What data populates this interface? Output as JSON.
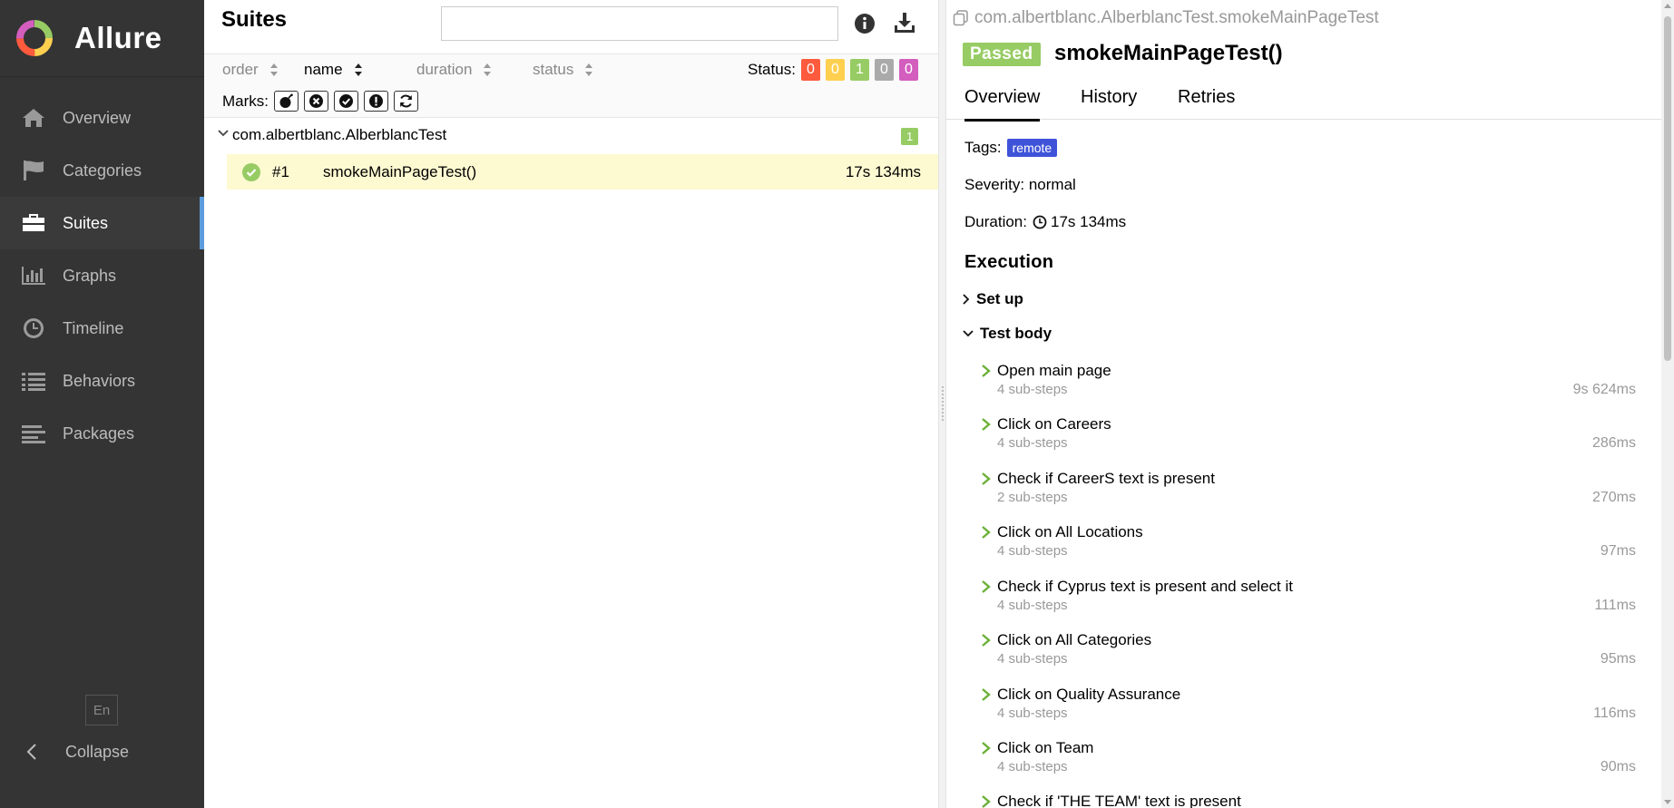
{
  "app": {
    "name": "Allure"
  },
  "sidebar": {
    "items": [
      {
        "label": "Overview",
        "icon": "home-icon"
      },
      {
        "label": "Categories",
        "icon": "flag-icon"
      },
      {
        "label": "Suites",
        "icon": "briefcase-icon",
        "active": true
      },
      {
        "label": "Graphs",
        "icon": "bar-chart-icon"
      },
      {
        "label": "Timeline",
        "icon": "clock-icon"
      },
      {
        "label": "Behaviors",
        "icon": "list-icon"
      },
      {
        "label": "Packages",
        "icon": "align-left-icon"
      }
    ],
    "language": "En",
    "collapse_label": "Collapse"
  },
  "suites_pane": {
    "title": "Suites",
    "search": {
      "value": "",
      "placeholder": ""
    },
    "sort": {
      "order": "order",
      "name": "name",
      "duration": "duration",
      "status": "status",
      "active": "name"
    },
    "status_label": "Status:",
    "status_counts": [
      {
        "status": "failed",
        "count": "0",
        "color": "#fd5a3e"
      },
      {
        "status": "broken",
        "count": "0",
        "color": "#ffd050"
      },
      {
        "status": "passed",
        "count": "1",
        "color": "#97cc64"
      },
      {
        "status": "skipped",
        "count": "0",
        "color": "#aaaaaa"
      },
      {
        "status": "unknown",
        "count": "0",
        "color": "#d35ebe"
      }
    ],
    "marks_label": "Marks:",
    "suite": {
      "name": "com.albertblanc.AlberblancTest",
      "count": "1"
    },
    "test": {
      "number": "#1",
      "name": "smokeMainPageTest()",
      "duration": "17s 134ms",
      "status": "passed"
    }
  },
  "detail": {
    "full_name": "com.albertblanc.AlberblancTest.smokeMainPageTest",
    "status": "Passed",
    "title": "smokeMainPageTest()",
    "tabs": [
      "Overview",
      "History",
      "Retries"
    ],
    "active_tab": "Overview",
    "tags_label": "Tags:",
    "tag": "remote",
    "severity": "Severity: normal",
    "duration_label": "Duration:",
    "duration": "17s 134ms",
    "execution_title": "Execution",
    "setup_label": "Set up",
    "body_label": "Test body",
    "steps": [
      {
        "name": "Open main page",
        "sub": "4 sub-steps",
        "duration": "9s 624ms"
      },
      {
        "name": "Click on Careers",
        "sub": "4 sub-steps",
        "duration": "286ms"
      },
      {
        "name": "Check if CareerS text is present",
        "sub": "2 sub-steps",
        "duration": "270ms"
      },
      {
        "name": "Click on All Locations",
        "sub": "4 sub-steps",
        "duration": "97ms"
      },
      {
        "name": "Check if Cyprus text is present and select it",
        "sub": "4 sub-steps",
        "duration": "111ms"
      },
      {
        "name": "Click on All Categories",
        "sub": "4 sub-steps",
        "duration": "95ms"
      },
      {
        "name": "Click on Quality Assurance",
        "sub": "4 sub-steps",
        "duration": "116ms"
      },
      {
        "name": "Click on Team",
        "sub": "4 sub-steps",
        "duration": "90ms"
      },
      {
        "name": "Check if 'THE TEAM' text is present",
        "sub": "",
        "duration": ""
      }
    ]
  }
}
